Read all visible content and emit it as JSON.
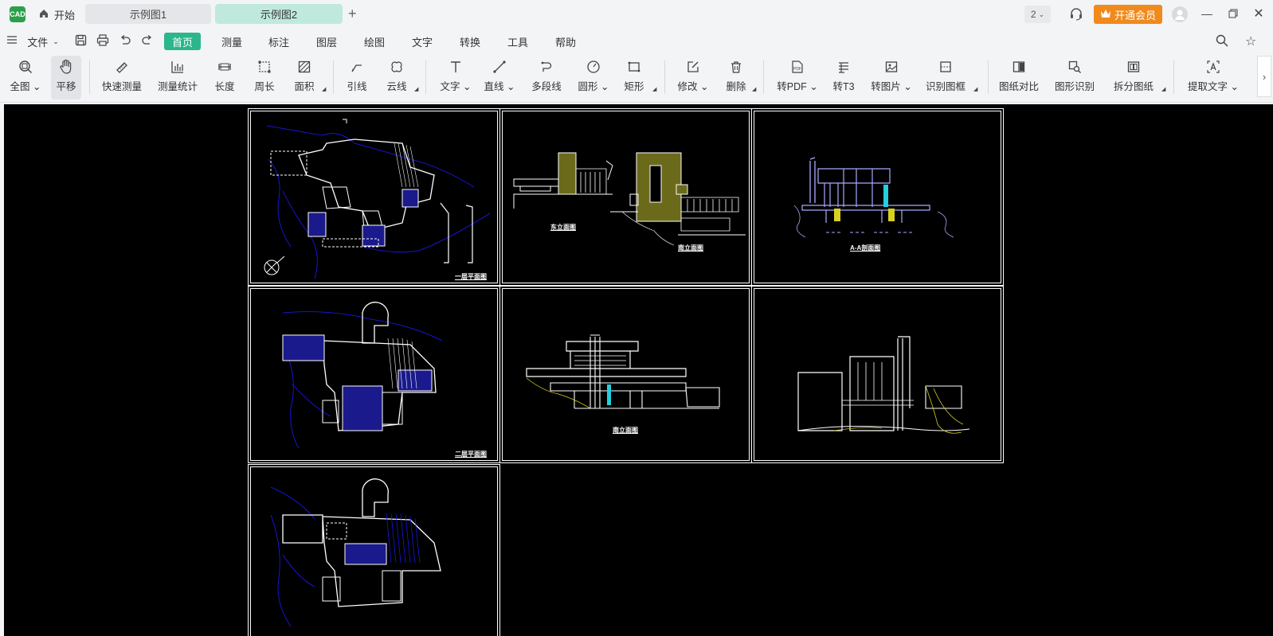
{
  "app": {
    "logo": "CAD"
  },
  "titlebar": {
    "home_label": "开始",
    "tabs": [
      {
        "label": "示例图1"
      },
      {
        "label": "示例图2"
      }
    ],
    "add_tab": "+",
    "page_count": "2",
    "vip_label": "开通会员"
  },
  "menubar": {
    "file": "文件",
    "items": [
      {
        "label": "首页"
      },
      {
        "label": "测量"
      },
      {
        "label": "标注"
      },
      {
        "label": "图层"
      },
      {
        "label": "绘图"
      },
      {
        "label": "文字"
      },
      {
        "label": "转换"
      },
      {
        "label": "工具"
      },
      {
        "label": "帮助"
      }
    ]
  },
  "toolbar": {
    "full": "全图",
    "pan": "平移",
    "quick_measure": "快速测量",
    "measure_stats": "测量统计",
    "length": "长度",
    "perimeter": "周长",
    "area": "面积",
    "leader": "引线",
    "cloud": "云线",
    "text": "文字",
    "line": "直线",
    "polyline": "多段线",
    "circle": "圆形",
    "rect": "矩形",
    "modify": "修改",
    "delete": "删除",
    "to_pdf": "转PDF",
    "to_t3": "转T3",
    "to_image": "转图片",
    "detect_frame": "识别图框",
    "compare": "图纸对比",
    "shape_recog": "图形识别",
    "split": "拆分图纸",
    "extract_text": "提取文字",
    "pdf_badge": "PDF"
  },
  "drawing": {
    "labels": {
      "floor1": "一层平面图",
      "east": "东立面图",
      "south_a": "南立面图",
      "section": "A-A剖面图",
      "floor2": "二层平面图",
      "south_b": "南立面图"
    },
    "colors": {
      "bg": "#000000",
      "line": "#ffffff",
      "blue": "#1a1aff",
      "navy": "#1a1a8c",
      "yellow": "#d8d020",
      "cyan": "#22d0e0",
      "lavender": "#a8a8ff"
    }
  }
}
